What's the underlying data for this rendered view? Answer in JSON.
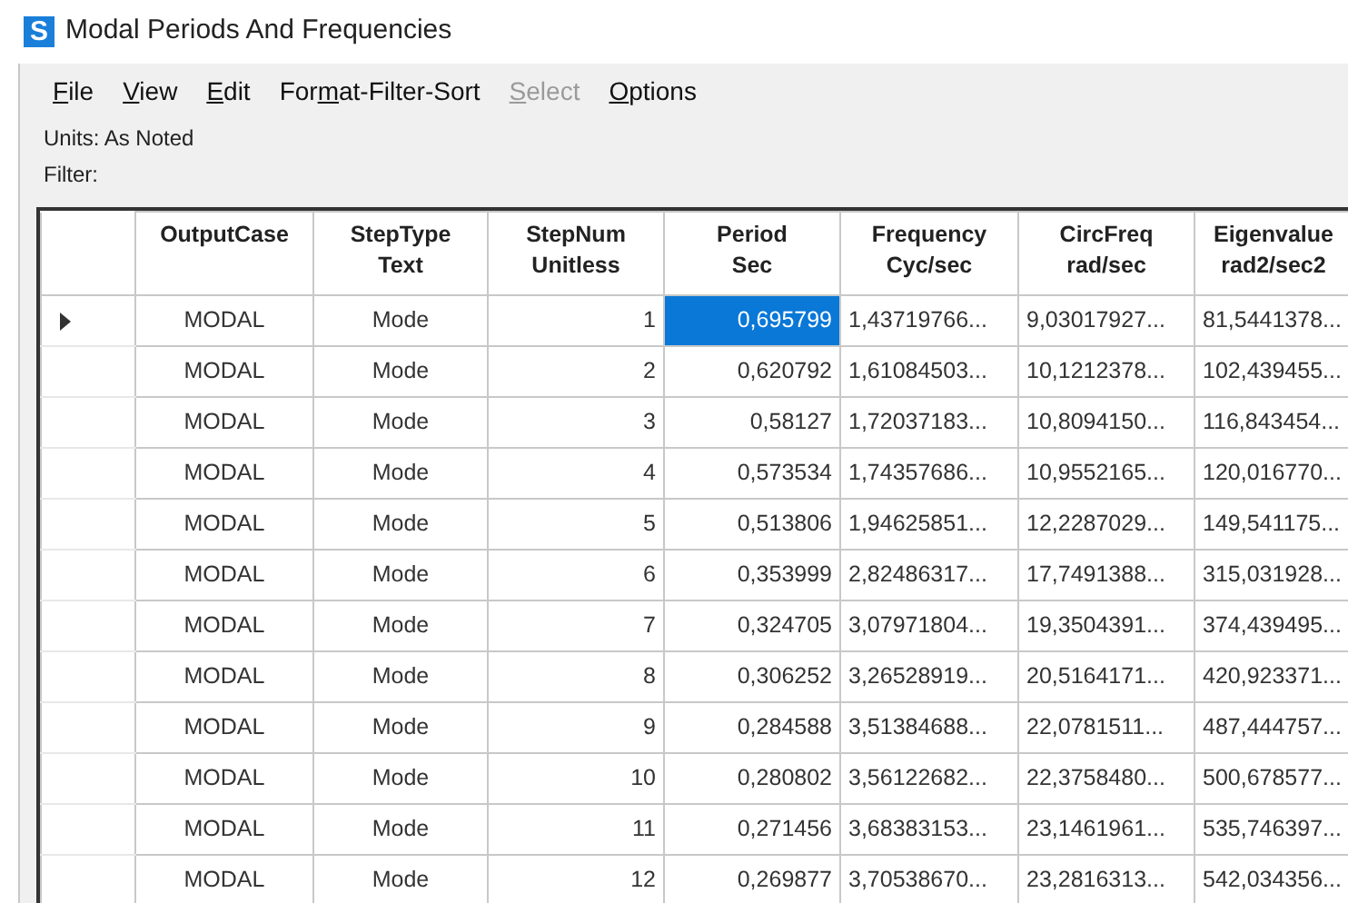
{
  "window": {
    "icon_letter": "S",
    "title": "Modal Periods And Frequencies"
  },
  "menu": [
    {
      "key": "F",
      "after": "ile",
      "disabled": false
    },
    {
      "key": "V",
      "after": "iew",
      "disabled": false
    },
    {
      "key": "E",
      "after": "dit",
      "disabled": false
    },
    {
      "before": "For",
      "key": "m",
      "after": "at-Filter-Sort",
      "disabled": false
    },
    {
      "key": "S",
      "after": "elect",
      "disabled": true
    },
    {
      "key": "O",
      "after": "ptions",
      "disabled": false
    }
  ],
  "info": {
    "units": "Units:  As Noted",
    "filter": "Filter:"
  },
  "table": {
    "columns": [
      {
        "title": "OutputCase",
        "kind": "text"
      },
      {
        "title": "StepType",
        "unit": "Text",
        "kind": "text"
      },
      {
        "title": "StepNum",
        "unit": "Unitless",
        "kind": "number"
      },
      {
        "title": "Period",
        "unit": "Sec",
        "kind": "number"
      },
      {
        "title": "Frequency",
        "unit": "Cyc/sec",
        "kind": "long"
      },
      {
        "title": "CircFreq",
        "unit": "rad/sec",
        "kind": "long"
      },
      {
        "title": "Eigenvalue",
        "unit": "rad2/sec2",
        "kind": "long"
      }
    ],
    "rows": [
      {
        "current": true,
        "cells": [
          {
            "text": "MODAL",
            "selected": false
          },
          {
            "text": "Mode",
            "selected": false
          },
          {
            "text": "1",
            "selected": false
          },
          {
            "text": "0,695799",
            "selected": true
          },
          {
            "text": "1,43719766...",
            "selected": false
          },
          {
            "text": "9,03017927...",
            "selected": false
          },
          {
            "text": "81,5441378...",
            "selected": false
          }
        ]
      },
      {
        "current": false,
        "cells": [
          {
            "text": "MODAL",
            "selected": false
          },
          {
            "text": "Mode",
            "selected": false
          },
          {
            "text": "2",
            "selected": false
          },
          {
            "text": "0,620792",
            "selected": false
          },
          {
            "text": "1,61084503...",
            "selected": false
          },
          {
            "text": "10,1212378...",
            "selected": false
          },
          {
            "text": "102,439455...",
            "selected": false
          }
        ]
      },
      {
        "current": false,
        "cells": [
          {
            "text": "MODAL",
            "selected": false
          },
          {
            "text": "Mode",
            "selected": false
          },
          {
            "text": "3",
            "selected": false
          },
          {
            "text": "0,58127",
            "selected": false
          },
          {
            "text": "1,72037183...",
            "selected": false
          },
          {
            "text": "10,8094150...",
            "selected": false
          },
          {
            "text": "116,843454...",
            "selected": false
          }
        ]
      },
      {
        "current": false,
        "cells": [
          {
            "text": "MODAL",
            "selected": false
          },
          {
            "text": "Mode",
            "selected": false
          },
          {
            "text": "4",
            "selected": false
          },
          {
            "text": "0,573534",
            "selected": false
          },
          {
            "text": "1,74357686...",
            "selected": false
          },
          {
            "text": "10,9552165...",
            "selected": false
          },
          {
            "text": "120,016770...",
            "selected": false
          }
        ]
      },
      {
        "current": false,
        "cells": [
          {
            "text": "MODAL",
            "selected": false
          },
          {
            "text": "Mode",
            "selected": false
          },
          {
            "text": "5",
            "selected": false
          },
          {
            "text": "0,513806",
            "selected": false
          },
          {
            "text": "1,94625851...",
            "selected": false
          },
          {
            "text": "12,2287029...",
            "selected": false
          },
          {
            "text": "149,541175...",
            "selected": false
          }
        ]
      },
      {
        "current": false,
        "cells": [
          {
            "text": "MODAL",
            "selected": false
          },
          {
            "text": "Mode",
            "selected": false
          },
          {
            "text": "6",
            "selected": false
          },
          {
            "text": "0,353999",
            "selected": false
          },
          {
            "text": "2,82486317...",
            "selected": false
          },
          {
            "text": "17,7491388...",
            "selected": false
          },
          {
            "text": "315,031928...",
            "selected": false
          }
        ]
      },
      {
        "current": false,
        "cells": [
          {
            "text": "MODAL",
            "selected": false
          },
          {
            "text": "Mode",
            "selected": false
          },
          {
            "text": "7",
            "selected": false
          },
          {
            "text": "0,324705",
            "selected": false
          },
          {
            "text": "3,07971804...",
            "selected": false
          },
          {
            "text": "19,3504391...",
            "selected": false
          },
          {
            "text": "374,439495...",
            "selected": false
          }
        ]
      },
      {
        "current": false,
        "cells": [
          {
            "text": "MODAL",
            "selected": false
          },
          {
            "text": "Mode",
            "selected": false
          },
          {
            "text": "8",
            "selected": false
          },
          {
            "text": "0,306252",
            "selected": false
          },
          {
            "text": "3,26528919...",
            "selected": false
          },
          {
            "text": "20,5164171...",
            "selected": false
          },
          {
            "text": "420,923371...",
            "selected": false
          }
        ]
      },
      {
        "current": false,
        "cells": [
          {
            "text": "MODAL",
            "selected": false
          },
          {
            "text": "Mode",
            "selected": false
          },
          {
            "text": "9",
            "selected": false
          },
          {
            "text": "0,284588",
            "selected": false
          },
          {
            "text": "3,51384688...",
            "selected": false
          },
          {
            "text": "22,0781511...",
            "selected": false
          },
          {
            "text": "487,444757...",
            "selected": false
          }
        ]
      },
      {
        "current": false,
        "cells": [
          {
            "text": "MODAL",
            "selected": false
          },
          {
            "text": "Mode",
            "selected": false
          },
          {
            "text": "10",
            "selected": false
          },
          {
            "text": "0,280802",
            "selected": false
          },
          {
            "text": "3,56122682...",
            "selected": false
          },
          {
            "text": "22,3758480...",
            "selected": false
          },
          {
            "text": "500,678577...",
            "selected": false
          }
        ]
      },
      {
        "current": false,
        "cells": [
          {
            "text": "MODAL",
            "selected": false
          },
          {
            "text": "Mode",
            "selected": false
          },
          {
            "text": "11",
            "selected": false
          },
          {
            "text": "0,271456",
            "selected": false
          },
          {
            "text": "3,68383153...",
            "selected": false
          },
          {
            "text": "23,1461961...",
            "selected": false
          },
          {
            "text": "535,746397...",
            "selected": false
          }
        ]
      },
      {
        "current": false,
        "cells": [
          {
            "text": "MODAL",
            "selected": false
          },
          {
            "text": "Mode",
            "selected": false
          },
          {
            "text": "12",
            "selected": false
          },
          {
            "text": "0,269877",
            "selected": false
          },
          {
            "text": "3,70538670...",
            "selected": false
          },
          {
            "text": "23,2816313...",
            "selected": false
          },
          {
            "text": "542,034356...",
            "selected": false
          }
        ]
      }
    ]
  }
}
